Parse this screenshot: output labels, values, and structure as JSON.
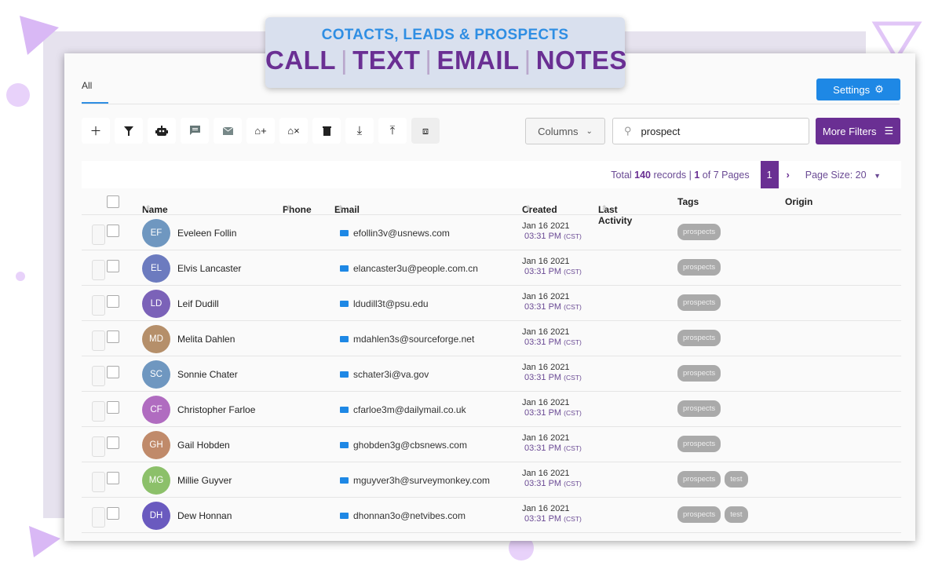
{
  "banner": {
    "subtitle": "COTACTS, LEADS & PROSPECTS",
    "items": [
      "CALL",
      "TEXT",
      "EMAIL",
      "NOTES"
    ]
  },
  "tabs": [
    {
      "label": "All"
    }
  ],
  "settings_label": "Settings",
  "toolbar": [
    "plus-icon",
    "filter-icon",
    "robot-icon",
    "message-icon",
    "mail-icon",
    "tag-add-icon",
    "tag-remove-icon",
    "trash-icon",
    "download-icon",
    "upload-icon",
    "merge-icon"
  ],
  "columns_label": "Columns",
  "search": {
    "value": "prospect"
  },
  "more_filters_label": "More Filters",
  "pager": {
    "total_prefix": "Total ",
    "total": "140",
    "total_suffix": " records | ",
    "page": "1",
    "of_pages": " of 7 Pages",
    "current": "1",
    "page_size": "Page Size: 20"
  },
  "headers": {
    "name": "Name",
    "phone": "Phone",
    "email": "Email",
    "created": "Created",
    "last_activity": "Last Activity",
    "tags": "Tags",
    "origin": "Origin"
  },
  "rows": [
    {
      "initials": "EF",
      "name": "Eveleen Follin",
      "email": "efollin3v@usnews.com",
      "date": "Jan 16 2021",
      "time": "03:31 PM",
      "tz": "(CST)",
      "tags": [
        "prospects"
      ],
      "color": "#6f97c0"
    },
    {
      "initials": "EL",
      "name": "Elvis Lancaster",
      "email": "elancaster3u@people.com.cn",
      "date": "Jan 16 2021",
      "time": "03:31 PM",
      "tz": "(CST)",
      "tags": [
        "prospects"
      ],
      "color": "#6c7bbf"
    },
    {
      "initials": "LD",
      "name": "Leif Dudill",
      "email": "ldudill3t@psu.edu",
      "date": "Jan 16 2021",
      "time": "03:31 PM",
      "tz": "(CST)",
      "tags": [
        "prospects"
      ],
      "color": "#7b62b8"
    },
    {
      "initials": "MD",
      "name": "Melita Dahlen",
      "email": "mdahlen3s@sourceforge.net",
      "date": "Jan 16 2021",
      "time": "03:31 PM",
      "tz": "(CST)",
      "tags": [
        "prospects"
      ],
      "color": "#b58f6a"
    },
    {
      "initials": "SC",
      "name": "Sonnie Chater",
      "email": "schater3i@va.gov",
      "date": "Jan 16 2021",
      "time": "03:31 PM",
      "tz": "(CST)",
      "tags": [
        "prospects"
      ],
      "color": "#6f97c0"
    },
    {
      "initials": "CF",
      "name": "Christopher Farloe",
      "email": "cfarloe3m@dailymail.co.uk",
      "date": "Jan 16 2021",
      "time": "03:31 PM",
      "tz": "(CST)",
      "tags": [
        "prospects"
      ],
      "color": "#b06cc0"
    },
    {
      "initials": "GH",
      "name": "Gail Hobden",
      "email": "ghobden3g@cbsnews.com",
      "date": "Jan 16 2021",
      "time": "03:31 PM",
      "tz": "(CST)",
      "tags": [
        "prospects"
      ],
      "color": "#c08a6a"
    },
    {
      "initials": "MG",
      "name": "Millie Guyver",
      "email": "mguyver3h@surveymonkey.com",
      "date": "Jan 16 2021",
      "time": "03:31 PM",
      "tz": "(CST)",
      "tags": [
        "prospects",
        "test"
      ],
      "color": "#8cc06a"
    },
    {
      "initials": "DH",
      "name": "Dew Honnan",
      "email": "dhonnan3o@netvibes.com",
      "date": "Jan 16 2021",
      "time": "03:31 PM",
      "tz": "(CST)",
      "tags": [
        "prospects",
        "test"
      ],
      "color": "#6a5abf"
    }
  ]
}
